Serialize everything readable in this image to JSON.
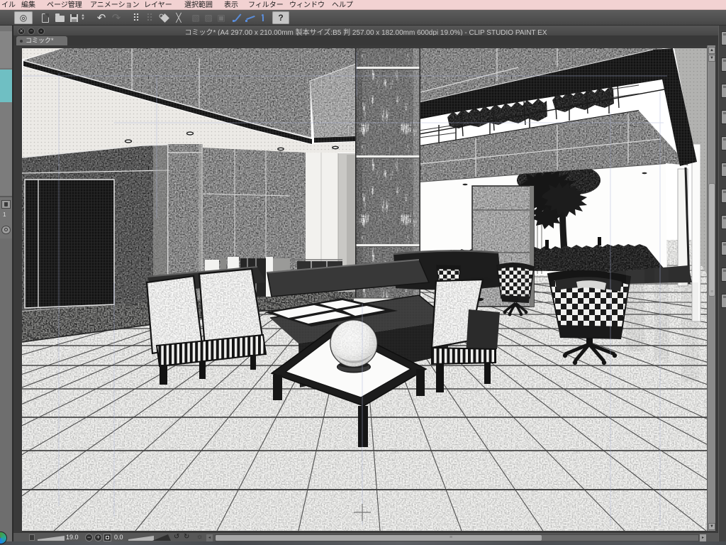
{
  "menu": {
    "items": [
      "イル",
      "編集",
      "ページ管理",
      "アニメーション",
      "レイヤー",
      "選択範囲",
      "表示",
      "フィルター",
      "ウィンドウ",
      "ヘルプ"
    ]
  },
  "toolbar": {
    "help_label": "?"
  },
  "document_window": {
    "title": "コミック* (A4 297.00 x 210.00mm 製本サイズ:B5 判 257.00 x 182.00mm 600dpi 19.0%)  - CLIP STUDIO PAINT EX",
    "tab_label": "コミック*"
  },
  "status_bar": {
    "zoom_value": "19.0",
    "rotation_value": "0.0"
  },
  "left_palette": {
    "layer_label": "1"
  },
  "colors": {
    "menu_bar_bg": "#f2d2d2",
    "toolbar_bg": "#4e4e4e",
    "title_bar_bg": "#4a4a4a",
    "canvas_frame_bg": "#3a3a3a",
    "accent_blue_tool": "#5b8dd9",
    "guide_blue": "#a9b2d9"
  }
}
